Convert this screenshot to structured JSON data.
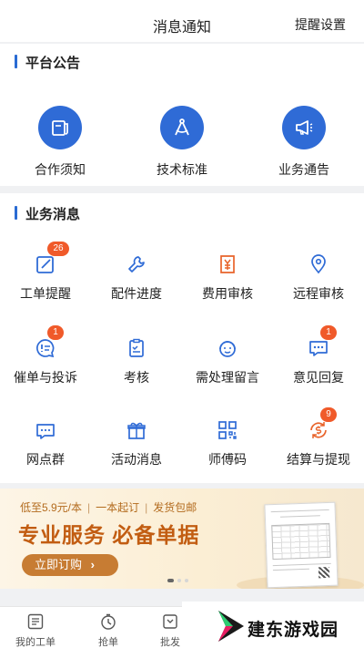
{
  "header": {
    "title": "消息通知",
    "settings_label": "提醒设置"
  },
  "platform": {
    "title": "平台公告",
    "items": [
      {
        "label": "合作须知",
        "icon": "document-icon"
      },
      {
        "label": "技术标准",
        "icon": "compass-icon"
      },
      {
        "label": "业务通告",
        "icon": "megaphone-icon"
      }
    ]
  },
  "business": {
    "title": "业务消息",
    "items": [
      {
        "label": "工单提醒",
        "icon": "edit-icon",
        "badge": "26"
      },
      {
        "label": "配件进度",
        "icon": "wrench-icon",
        "badge": ""
      },
      {
        "label": "费用审核",
        "icon": "yuan-icon",
        "badge": ""
      },
      {
        "label": "远程审核",
        "icon": "location-icon",
        "badge": ""
      },
      {
        "label": "催单与投诉",
        "icon": "alert-chat-icon",
        "badge": "1"
      },
      {
        "label": "考核",
        "icon": "clipboard-icon",
        "badge": ""
      },
      {
        "label": "需处理留言",
        "icon": "smile-icon",
        "badge": ""
      },
      {
        "label": "意见回复",
        "icon": "message-dots-icon",
        "badge": "1"
      },
      {
        "label": "网点群",
        "icon": "group-chat-icon",
        "badge": ""
      },
      {
        "label": "活动消息",
        "icon": "gift-icon",
        "badge": ""
      },
      {
        "label": "师傅码",
        "icon": "qrcode-icon",
        "badge": ""
      },
      {
        "label": "结算与提现",
        "icon": "money-cycle-icon",
        "badge": "9"
      }
    ]
  },
  "banner": {
    "price_text": "低至5.9元/本",
    "min_order_text": "一本起订",
    "shipping_text": "发货包邮",
    "separator": "|",
    "headline": "专业服务 必备单据",
    "cta_label": "立即订购",
    "cta_arrow": "›",
    "slide_count": 3,
    "active_slide": 1
  },
  "tabbar": {
    "items": [
      {
        "label": "我的工单",
        "icon": "list-icon"
      },
      {
        "label": "抢单",
        "icon": "timer-icon"
      },
      {
        "label": "批发",
        "icon": "cart-icon"
      }
    ]
  },
  "watermark": {
    "text": "建东游戏园"
  },
  "colors": {
    "accent": "#2f6bd6",
    "badge": "#f05a2a",
    "icon_orange": "#e8632a",
    "icon_blue": "#2f6bd6",
    "banner_text": "#c25d12"
  }
}
